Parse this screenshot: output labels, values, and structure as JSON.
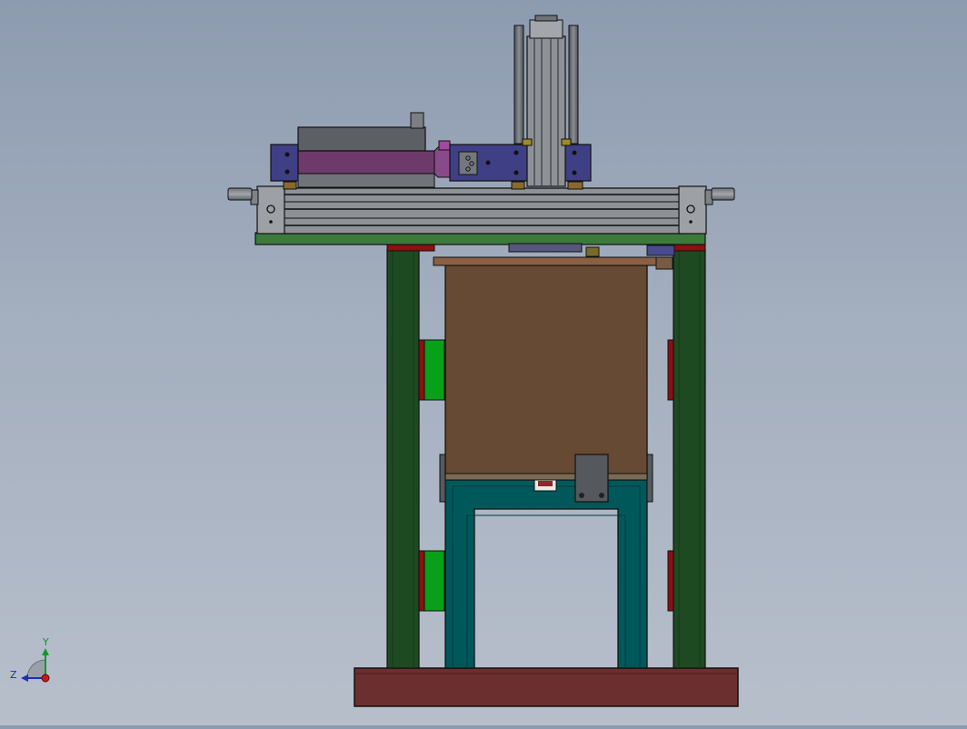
{
  "viewport": {
    "triad": {
      "axis_y_label": "Y",
      "axis_z_label": "Z",
      "axis_y_color": "#0f9a28",
      "axis_z_color": "#1a2fb8",
      "origin_color": "#c81818"
    }
  },
  "colors": {
    "background_top": "#8d9bb0",
    "background_bottom": "#b7bfcb",
    "frame_green": "#1e4a22",
    "base_plate": "#6b2f2f",
    "tank_brown": "#674a33",
    "lower_frame_teal": "#00585a",
    "cylinder_purple": "#6e3a6b",
    "slider_blue": "#3f3f85",
    "rodless_cylinder_gray": "#8e9196",
    "block_green": "#08a01a",
    "block_red": "#8c1010"
  }
}
